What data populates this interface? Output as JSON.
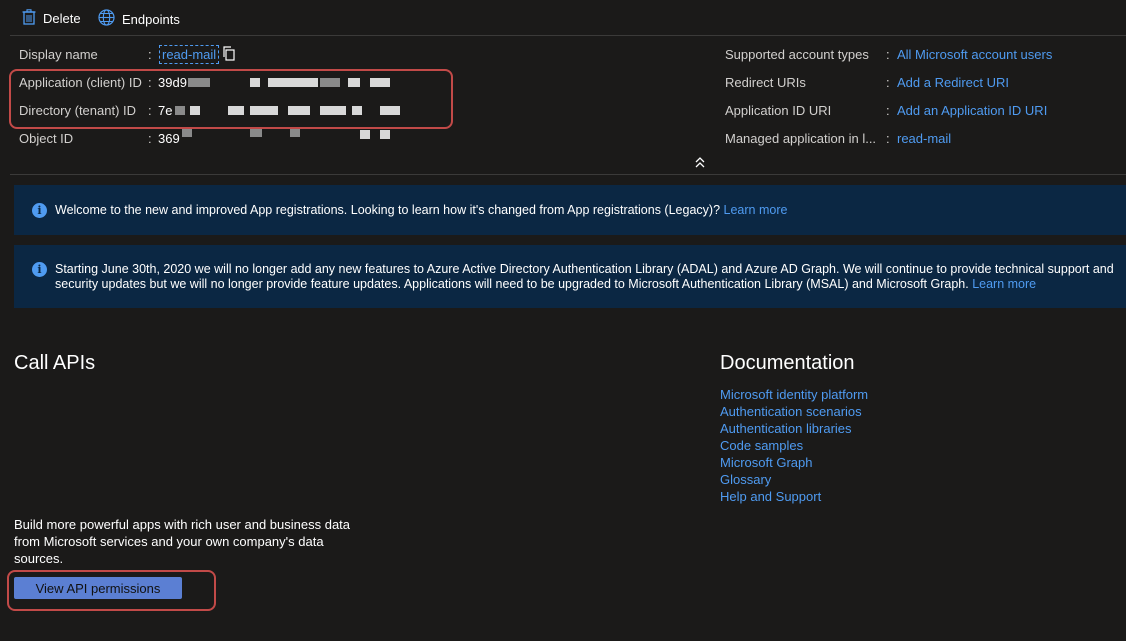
{
  "toolbar": {
    "delete_label": "Delete",
    "endpoints_label": "Endpoints"
  },
  "essentials": {
    "left": [
      {
        "label": "Display name",
        "value": "read-mail"
      },
      {
        "label": "Application (client) ID",
        "value": "39d9"
      },
      {
        "label": "Directory (tenant) ID",
        "value": "7e"
      },
      {
        "label": "Object ID",
        "value": "369"
      }
    ],
    "right": [
      {
        "label": "Supported account types",
        "value": "All Microsoft account users"
      },
      {
        "label": "Redirect URIs",
        "value": "Add a Redirect URI"
      },
      {
        "label": "Application ID URI",
        "value": "Add an Application ID URI"
      },
      {
        "label": "Managed application in l...",
        "value": "read-mail"
      }
    ],
    "colon": ":"
  },
  "banners": {
    "welcome_text": "Welcome to the new and improved App registrations. Looking to learn how it's changed from App registrations (Legacy)?",
    "welcome_link": "Learn more",
    "adal_text": "Starting June 30th, 2020 we will no longer add any new features to Azure Active Directory Authentication Library (ADAL) and Azure AD Graph. We will continue to provide technical support and security updates but we will no longer provide feature updates. Applications will need to be upgraded to Microsoft Authentication Library (MSAL) and Microsoft Graph.",
    "adal_link": "Learn more"
  },
  "call_apis": {
    "heading": "Call APIs",
    "description": "Build more powerful apps with rich user and business data from Microsoft services and your own company's data sources.",
    "button_label": "View API permissions"
  },
  "documentation": {
    "heading": "Documentation",
    "links": [
      "Microsoft identity platform",
      "Authentication scenarios",
      "Authentication libraries",
      "Code samples",
      "Microsoft Graph",
      "Glossary",
      "Help and Support"
    ]
  },
  "colors": {
    "background": "#1b1a19",
    "link": "#4f9bf1",
    "banner": "#0b2743",
    "button": "#5b7fd3",
    "highlight": "#c24a48"
  }
}
